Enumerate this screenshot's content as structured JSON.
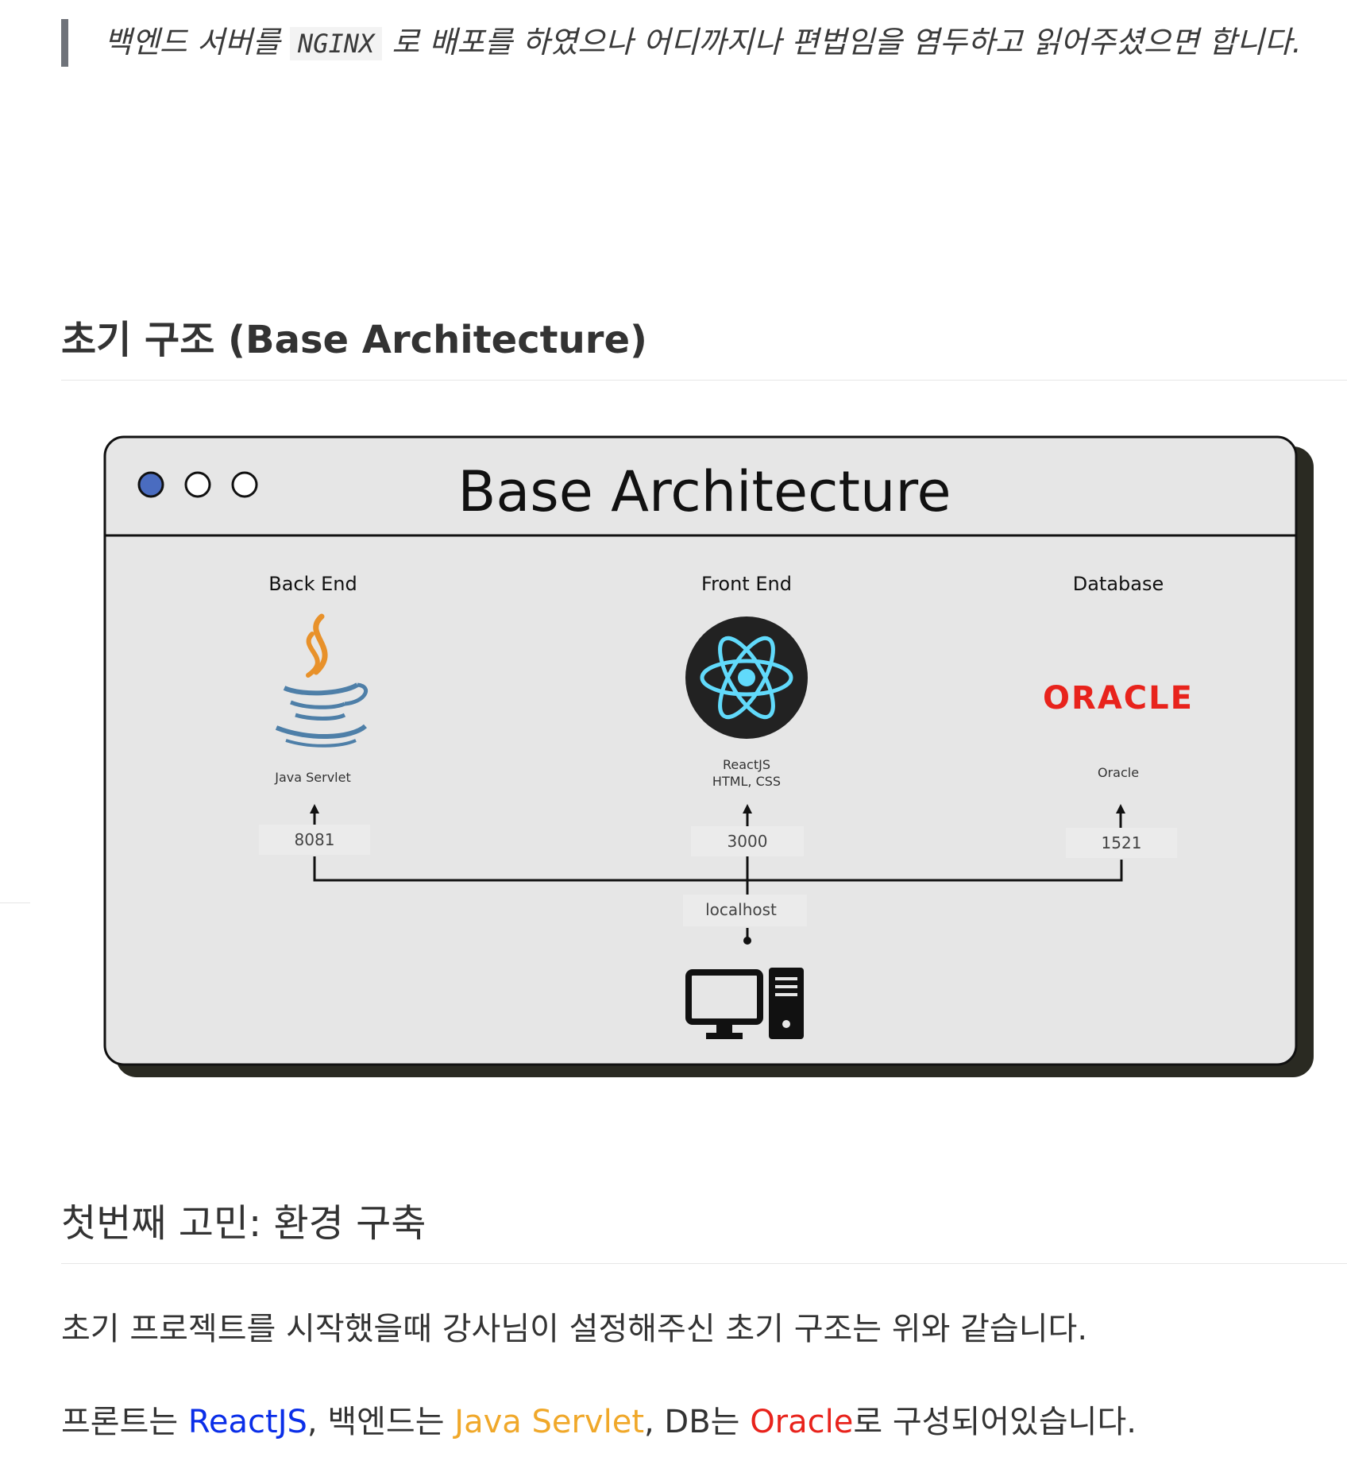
{
  "quote": {
    "before_code": "백엔드 서버를 ",
    "code": "NGINX",
    "after_code": " 로 배포를 하였으나 어디까지나 편법임을 염두하고 읽어주셨으면 합니다."
  },
  "heading_base": "초기 구조 (Base Architecture)",
  "figure": {
    "title": "Base Architecture",
    "backend": {
      "heading": "Back End",
      "caption": "Java Servlet",
      "port": "8081"
    },
    "frontend": {
      "heading": "Front End",
      "caption_line1": "ReactJS",
      "caption_line2": "HTML, CSS",
      "port": "3000"
    },
    "database": {
      "heading": "Database",
      "logo_text": "ORACLE",
      "caption": "Oracle",
      "port": "1521"
    },
    "host_label": "localhost",
    "colors": {
      "window_bg": "#e6e6e6",
      "shadow": "#2a2a22",
      "dot_active": "#4a6cc0",
      "react_bg": "#222222",
      "react_atom": "#61dafb",
      "oracle_red": "#e8231c",
      "java_orange": "#e8912a",
      "java_blue": "#4e7fa8"
    }
  },
  "heading_env": "첫번째 고민: 환경 구축",
  "para1": "초기 프로젝트를 시작했을때 강사님이 설정해주신 초기 구조는 위와 같습니다.",
  "para2": {
    "prefix": "프론트는 ",
    "react": "ReactJS",
    "sep1": ", 백엔드는 ",
    "java": "Java Servlet",
    "sep2": ", DB는 ",
    "oracle": "Oracle",
    "suffix": "로 구성되어있습니다."
  }
}
